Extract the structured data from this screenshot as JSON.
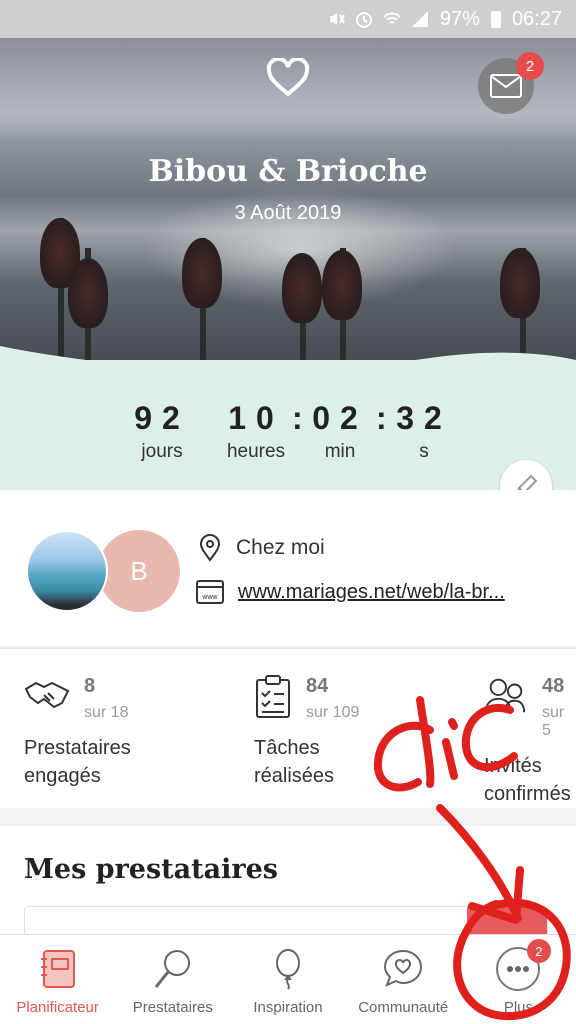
{
  "status_bar": {
    "battery": "97%",
    "time": "06:27"
  },
  "header": {
    "couple_name": "Bibou & Brioche",
    "date": "3 Août 2019",
    "mail_badge": "2"
  },
  "countdown": {
    "units": [
      {
        "value": "92",
        "label": "jours"
      },
      {
        "value": "10",
        "label": "heures"
      },
      {
        "value": "02",
        "label": "min"
      },
      {
        "value": "32",
        "label": "s"
      }
    ]
  },
  "info": {
    "avatar_initial": "B",
    "location": "Chez moi",
    "website": "www.mariages.net/web/la-br..."
  },
  "stats": [
    {
      "count": "8",
      "total": "sur 18",
      "label_line1": "Prestataires",
      "label_line2": "engagés",
      "icon": "handshake-icon"
    },
    {
      "count": "84",
      "total": "sur 109",
      "label_line1": "Tâches",
      "label_line2": "réalisées",
      "icon": "checklist-icon"
    },
    {
      "count": "48",
      "total": "sur 5",
      "label_line1": "Invités",
      "label_line2": "confirmés",
      "icon": "guests-icon"
    }
  ],
  "section": {
    "title": "Mes prestataires"
  },
  "nav": {
    "items": [
      {
        "label": "Planificateur",
        "icon": "planner-icon",
        "active": true
      },
      {
        "label": "Prestataires",
        "icon": "magnifier-icon"
      },
      {
        "label": "Inspiration",
        "icon": "balloon-icon"
      },
      {
        "label": "Communauté",
        "icon": "chat-heart-icon"
      },
      {
        "label": "Plus",
        "icon": "more-icon",
        "badge": "2"
      }
    ]
  },
  "annotation": {
    "text": "clic",
    "color": "#e0201c"
  },
  "colors": {
    "accent": "#e6564f",
    "countdown_bg": "#dcefea",
    "avatar_b": "#e8b7ae"
  }
}
